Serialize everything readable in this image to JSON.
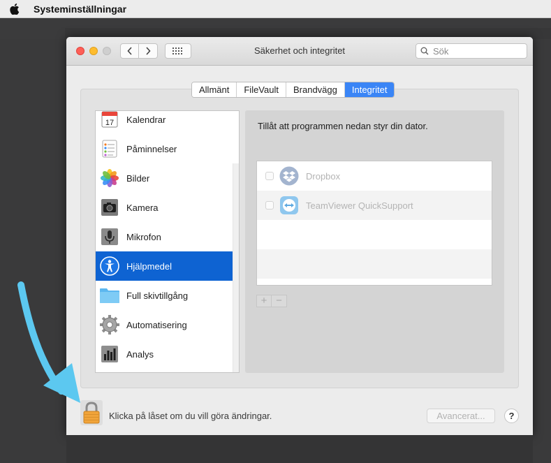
{
  "menubar": {
    "app_name": "Systeminställningar"
  },
  "window": {
    "title": "Säkerhet och integritet",
    "search_placeholder": "Sök"
  },
  "tabs": [
    {
      "label": "Allmänt",
      "active": false
    },
    {
      "label": "FileVault",
      "active": false
    },
    {
      "label": "Brandvägg",
      "active": false
    },
    {
      "label": "Integritet",
      "active": true
    }
  ],
  "sidebar": {
    "items": [
      {
        "label": "Kalendrar",
        "icon": "calendar-icon",
        "icon_text": "17"
      },
      {
        "label": "Påminnelser",
        "icon": "reminders-icon"
      },
      {
        "label": "Bilder",
        "icon": "photos-icon"
      },
      {
        "label": "Kamera",
        "icon": "camera-icon"
      },
      {
        "label": "Mikrofon",
        "icon": "microphone-icon"
      },
      {
        "label": "Hjälpmedel",
        "icon": "accessibility-icon",
        "selected": true
      },
      {
        "label": "Full skivtillgång",
        "icon": "folder-icon"
      },
      {
        "label": "Automatisering",
        "icon": "gear-icon"
      },
      {
        "label": "Analys",
        "icon": "analytics-icon"
      }
    ]
  },
  "main": {
    "description": "Tillåt att programmen nedan styr din dator.",
    "apps": [
      {
        "name": "Dropbox",
        "icon": "dropbox-icon",
        "checked": false
      },
      {
        "name": "TeamViewer QuickSupport",
        "icon": "teamviewer-icon",
        "checked": false
      }
    ],
    "add_label": "+",
    "remove_label": "−"
  },
  "footer": {
    "lock_text": "Klicka på låset om du vill göra ändringar.",
    "advanced_label": "Avancerat...",
    "help_label": "?"
  },
  "colors": {
    "selection_blue": "#0e63d2",
    "tab_active": "#3a85f6",
    "arrow": "#5cc8f0",
    "lock_gold": "#f1a43a"
  }
}
